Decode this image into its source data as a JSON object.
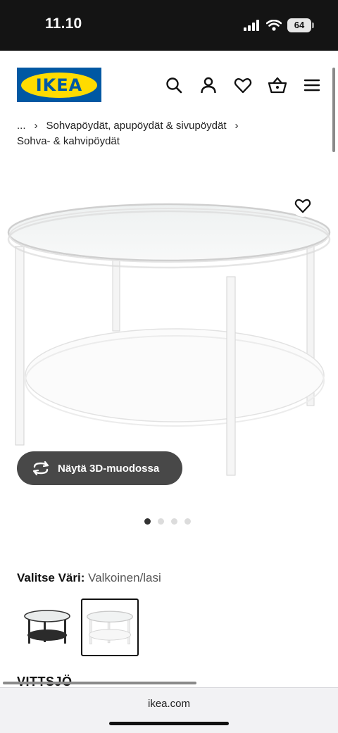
{
  "status_bar": {
    "time": "11.10",
    "battery": "64"
  },
  "header": {
    "logo_text": "IKEA",
    "icons": [
      "search-icon",
      "account-icon",
      "wishlist-icon",
      "cart-icon",
      "menu-icon"
    ]
  },
  "breadcrumb": {
    "ellipsis": "...",
    "category": "Sohvapöydät, apupöydät & sivupöydät",
    "current": "Sohva- & kahvipöydät"
  },
  "gallery": {
    "button_3d_label": "Näytä 3D-muodossa",
    "image_count": 4,
    "active_index": 0
  },
  "color": {
    "label": "Valitse Väri:",
    "value": "Valkoinen/lasi",
    "swatches": [
      {
        "name": "black-glass-table",
        "selected": false
      },
      {
        "name": "white-glass-table",
        "selected": true
      }
    ]
  },
  "product": {
    "name": "VITTSJÖ"
  },
  "browser": {
    "url": "ikea.com"
  },
  "colors": {
    "ikea_blue": "#0058a3",
    "ikea_yellow": "#ffdb00",
    "button_dark": "#484848"
  }
}
